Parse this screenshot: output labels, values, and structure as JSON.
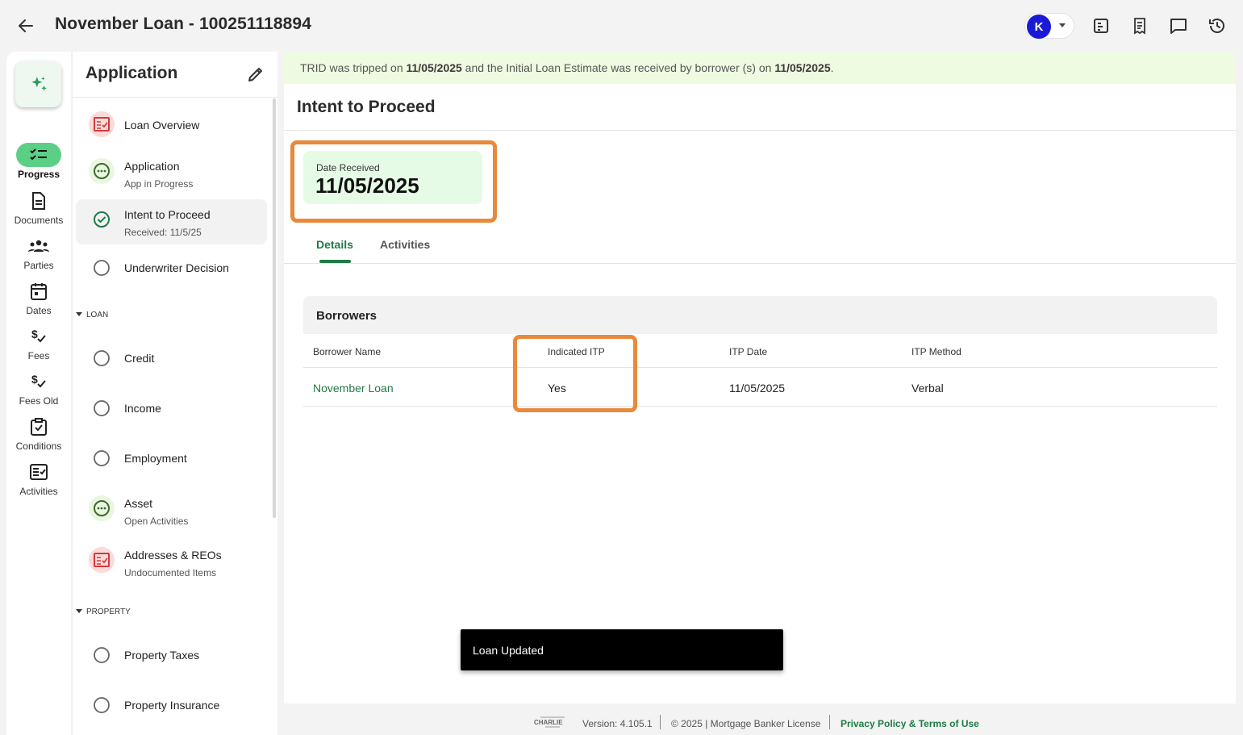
{
  "header": {
    "title": "November Loan - 100251118894",
    "user_initial": "K"
  },
  "rail": {
    "items": [
      {
        "label": "Progress",
        "icon": "progress-checklist-icon"
      },
      {
        "label": "Documents",
        "icon": "document-icon"
      },
      {
        "label": "Parties",
        "icon": "people-group-icon"
      },
      {
        "label": "Dates",
        "icon": "calendar-icon"
      },
      {
        "label": "Fees",
        "icon": "dollar-check-icon"
      },
      {
        "label": "Fees Old",
        "icon": "dollar-check-icon"
      },
      {
        "label": "Conditions",
        "icon": "clipboard-check-icon"
      },
      {
        "label": "Activities",
        "icon": "activity-list-icon"
      }
    ]
  },
  "sidebar": {
    "title": "Application",
    "items": [
      {
        "label": "Loan Overview",
        "sub": "",
        "status": "alert"
      },
      {
        "label": "Application",
        "sub": "App in Progress",
        "status": "in-progress"
      },
      {
        "label": "Intent to Proceed",
        "sub": "Received: 11/5/25",
        "status": "complete"
      },
      {
        "label": "Underwriter Decision",
        "sub": "",
        "status": "empty"
      }
    ],
    "loan_section": "LOAN",
    "loan_items": [
      {
        "label": "Credit",
        "sub": "",
        "status": "empty"
      },
      {
        "label": "Income",
        "sub": "",
        "status": "empty"
      },
      {
        "label": "Employment",
        "sub": "",
        "status": "empty"
      },
      {
        "label": "Asset",
        "sub": "Open Activities",
        "status": "in-progress"
      },
      {
        "label": "Addresses & REOs",
        "sub": "Undocumented Items",
        "status": "alert"
      }
    ],
    "property_section": "PROPERTY",
    "property_items": [
      {
        "label": "Property Taxes",
        "sub": "",
        "status": "empty"
      },
      {
        "label": "Property Insurance",
        "sub": "",
        "status": "empty"
      }
    ]
  },
  "banner": {
    "prefix": "TRID was tripped on ",
    "date1": "11/05/2025",
    "middle": " and the Initial Loan Estimate was received by borrower (s) on ",
    "date2": "11/05/2025",
    "suffix": "."
  },
  "main": {
    "title": "Intent to Proceed",
    "date_received_label": "Date Received",
    "date_received_value": "11/05/2025",
    "tabs": [
      {
        "label": "Details",
        "active": true
      },
      {
        "label": "Activities",
        "active": false
      }
    ]
  },
  "borrowers": {
    "title": "Borrowers",
    "columns": [
      "Borrower Name",
      "Indicated ITP",
      "ITP Date",
      "ITP Method"
    ],
    "rows": [
      {
        "name": "November Loan",
        "indicated_itp": "Yes",
        "itp_date": "11/05/2025",
        "itp_method": "Verbal"
      }
    ]
  },
  "toast": {
    "message": "Loan Updated"
  },
  "footer": {
    "logo": "CHARLIE",
    "version": "Version: 4.105.1",
    "license": "© 2025 | Mortgage Banker License",
    "link": "Privacy Policy & Terms of Use"
  },
  "colors": {
    "accent_green": "#1f7a45",
    "highlight_orange": "#e8893c",
    "banner_bg": "#eefbe1",
    "avatar_blue": "#1a1ad6"
  }
}
